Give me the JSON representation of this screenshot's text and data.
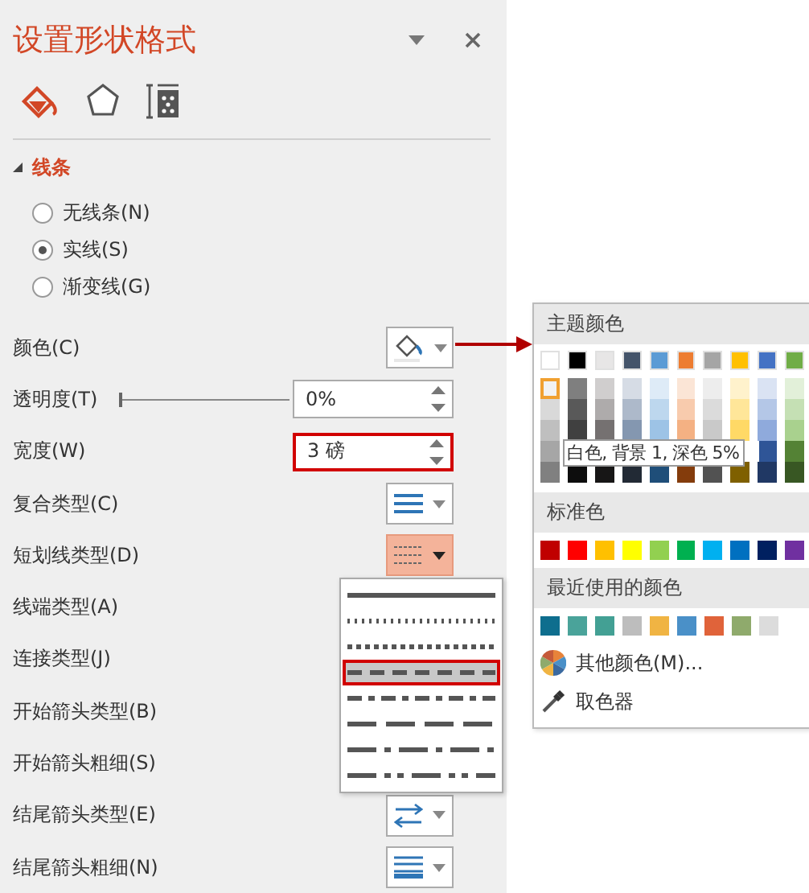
{
  "pane": {
    "title": "设置形状格式",
    "tabs": [
      {
        "kind": "fill",
        "selected": true
      },
      {
        "kind": "effects",
        "selected": false
      },
      {
        "kind": "size",
        "selected": false
      }
    ],
    "section": {
      "title": "线条",
      "expanded": true
    },
    "radios": [
      {
        "label": "无线条(N)",
        "selected": false
      },
      {
        "label": "实线(S)",
        "selected": true
      },
      {
        "label": "渐变线(G)",
        "selected": false
      }
    ],
    "rows": [
      {
        "label": "颜色(C)",
        "kind": "color"
      },
      {
        "label": "透明度(T)",
        "kind": "slider",
        "value": "0%",
        "level": 0
      },
      {
        "label": "宽度(W)",
        "kind": "spin",
        "value": "3 磅",
        "highlighted": true
      },
      {
        "label": "复合类型(C)",
        "kind": "compound",
        "open": false
      },
      {
        "label": "短划线类型(D)",
        "kind": "dash",
        "open": true
      },
      {
        "label": "线端类型(A)",
        "kind": "none"
      },
      {
        "label": "连接类型(J)",
        "kind": "none"
      },
      {
        "label": "开始箭头类型(B)",
        "kind": "none"
      },
      {
        "label": "开始箭头粗细(S)",
        "kind": "none"
      },
      {
        "label": "结尾箭头类型(E)",
        "kind": "arrows",
        "open": false
      },
      {
        "label": "结尾箭头粗细(N)",
        "kind": "weight",
        "open": false
      }
    ]
  },
  "dash_menu": [
    {
      "kind": "solid",
      "selected": false
    },
    {
      "kind": "round-dot",
      "selected": false
    },
    {
      "kind": "square-dot",
      "selected": false
    },
    {
      "kind": "dash",
      "selected": true
    },
    {
      "kind": "dash-dot",
      "selected": false
    },
    {
      "kind": "long-dash",
      "selected": false
    },
    {
      "kind": "long-dash-dot",
      "selected": false
    },
    {
      "kind": "long-dash-dot-dot",
      "selected": false
    }
  ],
  "color_menu": {
    "theme_title": "主题颜色",
    "theme_rows": [
      {
        "swatches": [
          {
            "color": "#ffffff",
            "selected": false
          },
          {
            "color": "#000000",
            "selected": false
          },
          {
            "color": "#e7e6e6",
            "selected": false
          },
          {
            "color": "#44546a",
            "selected": false
          },
          {
            "color": "#5b9bd5",
            "selected": false
          },
          {
            "color": "#ed7d31",
            "selected": false
          },
          {
            "color": "#a5a5a5",
            "selected": false
          },
          {
            "color": "#ffc000",
            "selected": false
          },
          {
            "color": "#4472c4",
            "selected": false
          },
          {
            "color": "#70ad47",
            "selected": false
          }
        ]
      },
      {
        "swatches": [
          {
            "color": "#f2f2f2",
            "selected": true
          },
          {
            "color": "#7f7f7f",
            "selected": false
          },
          {
            "color": "#d0cece",
            "selected": false
          },
          {
            "color": "#d6dce5",
            "selected": false
          },
          {
            "color": "#deebf7",
            "selected": false
          },
          {
            "color": "#fbe5d6",
            "selected": false
          },
          {
            "color": "#ededed",
            "selected": false
          },
          {
            "color": "#fff2cc",
            "selected": false
          },
          {
            "color": "#dae3f3",
            "selected": false
          },
          {
            "color": "#e2f0d9",
            "selected": false
          }
        ]
      },
      {
        "swatches": [
          {
            "color": "#d9d9d9",
            "selected": false
          },
          {
            "color": "#595959",
            "selected": false
          },
          {
            "color": "#aeabab",
            "selected": false
          },
          {
            "color": "#adb9ca",
            "selected": false
          },
          {
            "color": "#bdd7ee",
            "selected": false
          },
          {
            "color": "#f8cbad",
            "selected": false
          },
          {
            "color": "#dbdbdb",
            "selected": false
          },
          {
            "color": "#ffe699",
            "selected": false
          },
          {
            "color": "#b4c7e7",
            "selected": false
          },
          {
            "color": "#c5e0b4",
            "selected": false
          }
        ]
      },
      {
        "swatches": [
          {
            "color": "#bfbfbf",
            "selected": false
          },
          {
            "color": "#404040",
            "selected": false
          },
          {
            "color": "#757171",
            "selected": false
          },
          {
            "color": "#8497b0",
            "selected": false
          },
          {
            "color": "#9dc3e6",
            "selected": false
          },
          {
            "color": "#f4b183",
            "selected": false
          },
          {
            "color": "#c9c9c9",
            "selected": false
          },
          {
            "color": "#ffd966",
            "selected": false
          },
          {
            "color": "#8faadc",
            "selected": false
          },
          {
            "color": "#a9d18e",
            "selected": false
          }
        ]
      },
      {
        "swatches": [
          {
            "color": "#a6a6a6",
            "selected": false
          }
        ],
        "tooltip": "白色, 背景 1, 深色 5%",
        "swatches_after": [
          {
            "color": "#2f5597",
            "selected": false
          },
          {
            "color": "#548235",
            "selected": false
          }
        ]
      },
      {
        "swatches": [
          {
            "color": "#808080",
            "selected": false
          },
          {
            "color": "#0d0d0d",
            "selected": false
          },
          {
            "color": "#171616",
            "selected": false
          },
          {
            "color": "#222a35",
            "selected": false
          },
          {
            "color": "#1f4e79",
            "selected": false
          },
          {
            "color": "#843c0c",
            "selected": false
          },
          {
            "color": "#525252",
            "selected": false
          },
          {
            "color": "#7f6000",
            "selected": false
          },
          {
            "color": "#203864",
            "selected": false
          },
          {
            "color": "#385723",
            "selected": false
          }
        ]
      }
    ],
    "standard_title": "标准色",
    "standard": [
      {
        "color": "#c00000"
      },
      {
        "color": "#ff0000"
      },
      {
        "color": "#ffc000"
      },
      {
        "color": "#ffff00"
      },
      {
        "color": "#92d050"
      },
      {
        "color": "#00b050"
      },
      {
        "color": "#00b0f0"
      },
      {
        "color": "#0070c0"
      },
      {
        "color": "#002060"
      },
      {
        "color": "#7030a0"
      }
    ],
    "recent_title": "最近使用的颜色",
    "recent": [
      {
        "color": "#0e6e8e"
      },
      {
        "color": "#4aa39a"
      },
      {
        "color": "#43a094"
      },
      {
        "color": "#bdbdbd"
      },
      {
        "color": "#f0b443"
      },
      {
        "color": "#4a90c8"
      },
      {
        "color": "#e0633a"
      },
      {
        "color": "#8faa6c"
      },
      {
        "color": "#dcdcdc"
      }
    ],
    "more_colors": "其他颜色(M)...",
    "eyedropper": "取色器"
  }
}
